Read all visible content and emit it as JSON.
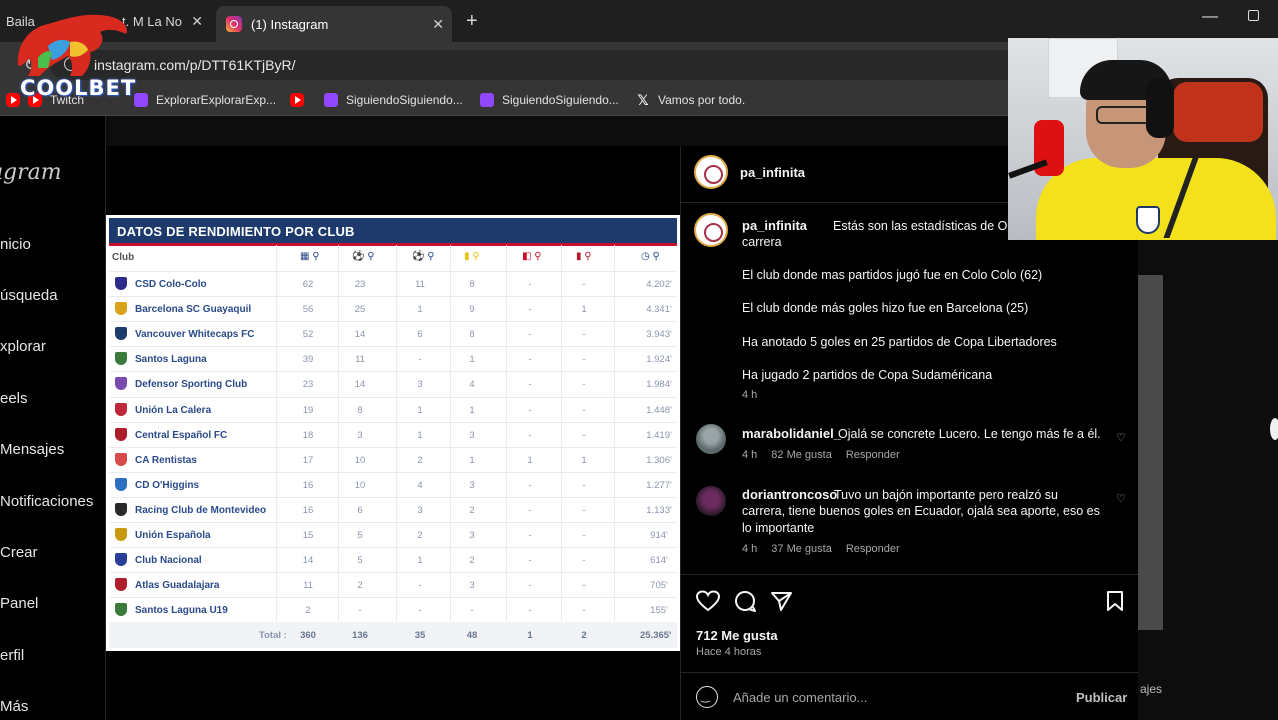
{
  "browser": {
    "tabs": [
      {
        "label": "Baila",
        "label2": "t. M La No"
      },
      {
        "label": "(1) Instagram"
      }
    ],
    "url": "instagram.com/p/DTT61KTjByR/",
    "bookmarks": [
      {
        "icon": "youtube-icon",
        "label": ""
      },
      {
        "icon": "youtube-icon",
        "label": "Twitch"
      },
      {
        "icon": "twitch-icon",
        "label": "ExplorarExplorarExp..."
      },
      {
        "icon": "youtube-icon",
        "label": ""
      },
      {
        "icon": "twitch-icon",
        "label": "SiguiendoSiguiendo..."
      },
      {
        "icon": "twitch-icon",
        "label": "SiguiendoSiguiendo..."
      },
      {
        "icon": "x-icon",
        "label": "Vamos por todo."
      }
    ]
  },
  "overlay": {
    "logo_text": "COOLBET"
  },
  "instagram": {
    "logo": "Instagram",
    "nav": [
      "Inicio",
      "Búsqueda",
      "Explorar",
      "Reels",
      "Mensajes",
      "Notificaciones",
      "Crear",
      "Panel",
      "Perfil",
      "Más"
    ],
    "nav_visible": [
      "nicio",
      "úsqueda",
      "xplorar",
      "eels",
      "Mensajes",
      "Notificaciones",
      "Crear",
      "Panel",
      "erfil",
      "Más"
    ],
    "right_cut_label": "ajes"
  },
  "stats_image": {
    "title": "DATOS DE RENDIMIENTO POR CLUB",
    "club_header": "Club",
    "columns": [
      "Partidos",
      "Goles",
      "Asistencias",
      "Amarillas",
      "Doble amarilla",
      "Rojas",
      "Minutos"
    ],
    "rows": [
      {
        "club": "CSD Colo-Colo",
        "badge": "#2b2b8a",
        "vals": [
          "62",
          "23",
          "11",
          "8",
          "-",
          "-",
          "4.202'"
        ]
      },
      {
        "club": "Barcelona SC Guayaquil",
        "badge": "#d9a21b",
        "vals": [
          "56",
          "25",
          "1",
          "9",
          "-",
          "1",
          "4.341'"
        ]
      },
      {
        "club": "Vancouver Whitecaps FC",
        "badge": "#1c3a6b",
        "vals": [
          "52",
          "14",
          "6",
          "8",
          "-",
          "-",
          "3.943'"
        ]
      },
      {
        "club": "Santos Laguna",
        "badge": "#3a7a3a",
        "vals": [
          "39",
          "11",
          "-",
          "1",
          "-",
          "-",
          "1.924'"
        ]
      },
      {
        "club": "Defensor Sporting Club",
        "badge": "#7a4ab0",
        "vals": [
          "23",
          "14",
          "3",
          "4",
          "-",
          "-",
          "1.984'"
        ]
      },
      {
        "club": "Unión La Calera",
        "badge": "#c0283a",
        "vals": [
          "19",
          "8",
          "1",
          "1",
          "-",
          "-",
          "1.448'"
        ]
      },
      {
        "club": "Central Español FC",
        "badge": "#b01d2a",
        "vals": [
          "18",
          "3",
          "1",
          "3",
          "-",
          "-",
          "1.419'"
        ]
      },
      {
        "club": "CA Rentistas",
        "badge": "#d64a4a",
        "vals": [
          "17",
          "10",
          "2",
          "1",
          "1",
          "1",
          "1.306'"
        ]
      },
      {
        "club": "CD O'Higgins",
        "badge": "#2f6fc0",
        "vals": [
          "16",
          "10",
          "4",
          "3",
          "-",
          "-",
          "1.277'"
        ]
      },
      {
        "club": "Racing Club de Montevideo",
        "badge": "#2a2a2a",
        "vals": [
          "16",
          "6",
          "3",
          "2",
          "-",
          "-",
          "1.133'"
        ]
      },
      {
        "club": "Unión Española",
        "badge": "#c99a10",
        "vals": [
          "15",
          "5",
          "2",
          "3",
          "-",
          "-",
          "914'"
        ]
      },
      {
        "club": "Club Nacional",
        "badge": "#2a3f9a",
        "vals": [
          "14",
          "5",
          "1",
          "2",
          "-",
          "-",
          "614'"
        ]
      },
      {
        "club": "Atlas Guadalajara",
        "badge": "#b01d2a",
        "vals": [
          "11",
          "2",
          "-",
          "3",
          "-",
          "-",
          "705'"
        ]
      },
      {
        "club": "Santos Laguna U19",
        "badge": "#3a7a3a",
        "vals": [
          "2",
          "-",
          "-",
          "-",
          "-",
          "-",
          "155'"
        ]
      }
    ],
    "total_label": "Total :",
    "totals": [
      "360",
      "136",
      "35",
      "48",
      "1",
      "2",
      "25.365'"
    ]
  },
  "post": {
    "author": "pa_infinita",
    "caption_author": "pa_infinita",
    "caption_line1": "Estás son las estadísticas de Octavio",
    "caption_line2": "carrera",
    "paragraphs": [
      "El club donde mas partidos jugó fue en Colo Colo (62)",
      "El club donde más goles hizo fue en Barcelona (25)",
      "Ha anotado 5 goles en 25 partidos de Copa Libertadores",
      "Ha jugado 2 partidos de Copa Sudaméricana"
    ],
    "caption_time": "4 h",
    "comments": [
      {
        "user": "marabolidaniel_",
        "text": "Ojalá se concrete Lucero. Le tengo más fe a él.",
        "time": "4 h",
        "likes": "82 Me gusta",
        "reply": "Responder"
      },
      {
        "user": "doriantroncoso",
        "text1": "Tuvo un bajón importante pero realzó su",
        "text2": "carrera, tiene buenos goles en Ecuador, ojalá sea aporte, eso es",
        "text3": "lo importante",
        "time": "4 h",
        "likes": "37 Me gusta",
        "reply": "Responder"
      }
    ],
    "likes": "712 Me gusta",
    "ago": "Hace 4 horas",
    "comment_placeholder": "Añade un comentario...",
    "publish": "Publicar"
  }
}
